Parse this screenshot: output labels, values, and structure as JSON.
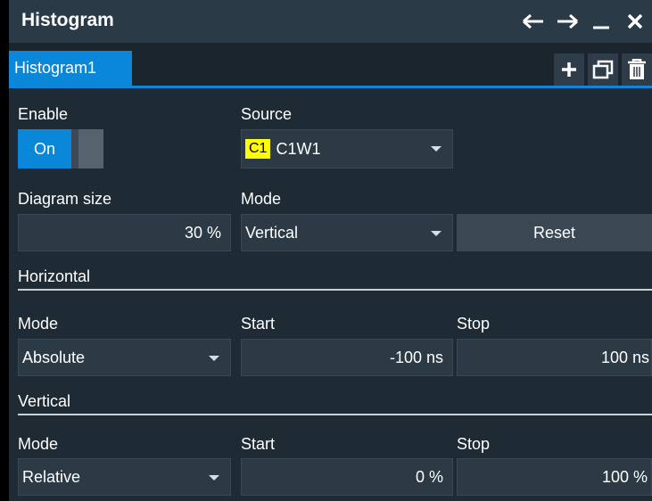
{
  "window": {
    "title": "Histogram",
    "icons": [
      "back-arrow-icon",
      "forward-arrow-icon",
      "minimize-icon",
      "close-icon"
    ]
  },
  "tabs": [
    {
      "label": "Histogram1",
      "active": true
    }
  ],
  "tab_actions": [
    "add-icon",
    "window-icon",
    "delete-icon"
  ],
  "enable": {
    "label": "Enable",
    "value": "On"
  },
  "source": {
    "label": "Source",
    "badge": "C1",
    "value": "C1W1",
    "badge_color": "#ffff00"
  },
  "diagram_size": {
    "label": "Diagram size",
    "value": "30 %"
  },
  "mode": {
    "label": "Mode",
    "value": "Vertical"
  },
  "reset": {
    "label": "Reset"
  },
  "horizontal": {
    "heading": "Horizontal",
    "mode_label": "Mode",
    "mode_value": "Absolute",
    "start_label": "Start",
    "start_value": "-100 ns",
    "stop_label": "Stop",
    "stop_value": "100 ns"
  },
  "vertical": {
    "heading": "Vertical",
    "mode_label": "Mode",
    "mode_value": "Relative",
    "start_label": "Start",
    "start_value": "0 %",
    "stop_label": "Stop",
    "stop_value": "100 %"
  },
  "colors": {
    "accent": "#0a87d8",
    "panel": "#1e2a34",
    "field": "#2c3a45"
  }
}
